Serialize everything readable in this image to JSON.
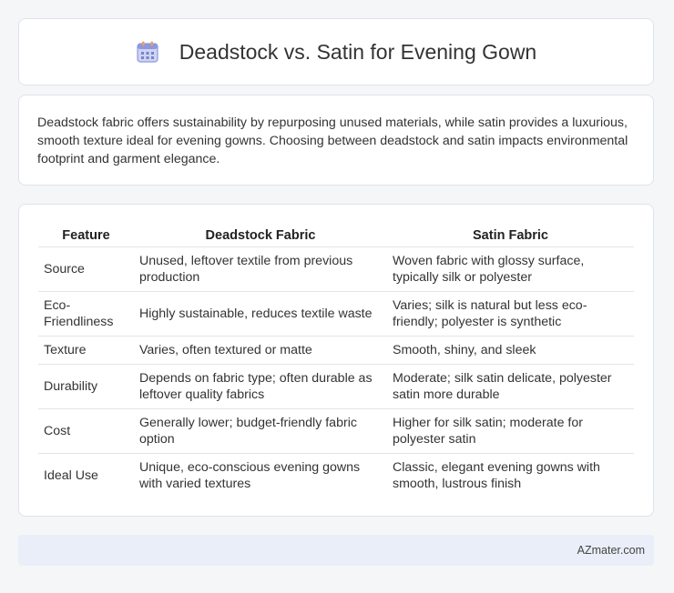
{
  "header": {
    "title": "Deadstock vs. Satin for Evening Gown",
    "icon": "calendar-icon"
  },
  "intro": {
    "text": "Deadstock fabric offers sustainability by repurposing unused materials, while satin provides a luxurious, smooth texture ideal for evening gowns. Choosing between deadstock and satin impacts environmental footprint and garment elegance."
  },
  "table": {
    "headers": [
      "Feature",
      "Deadstock Fabric",
      "Satin Fabric"
    ],
    "rows": [
      [
        "Source",
        "Unused, leftover textile from previous production",
        "Woven fabric with glossy surface, typically silk or polyester"
      ],
      [
        "Eco-Friendliness",
        "Highly sustainable, reduces textile waste",
        "Varies; silk is natural but less eco-friendly; polyester is synthetic"
      ],
      [
        "Texture",
        "Varies, often textured or matte",
        "Smooth, shiny, and sleek"
      ],
      [
        "Durability",
        "Depends on fabric type; often durable as leftover quality fabrics",
        "Moderate; silk satin delicate, polyester satin more durable"
      ],
      [
        "Cost",
        "Generally lower; budget-friendly fabric option",
        "Higher for silk satin; moderate for polyester satin"
      ],
      [
        "Ideal Use",
        "Unique, eco-conscious evening gowns with varied textures",
        "Classic, elegant evening gowns with smooth, lustrous finish"
      ]
    ]
  },
  "footer": {
    "brand": "AZmater.com"
  }
}
